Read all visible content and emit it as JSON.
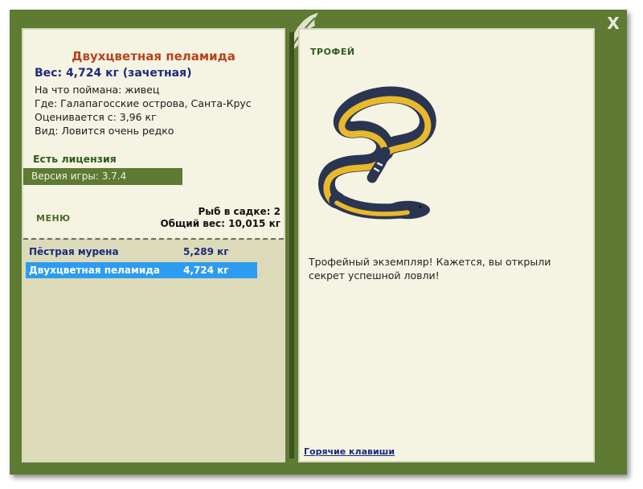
{
  "window": {
    "close_label": "X"
  },
  "fish": {
    "name": "Двухцветная пеламида",
    "weight_line": "Вес: 4,724 кг (зачетная)",
    "info": [
      "На что поймана: живец",
      "Где: Галапагосские острова, Санта-Крус",
      "Оценивается с: 3,96 кг",
      "Вид: Ловится очень редко"
    ]
  },
  "license": "Есть лицензия",
  "version": "Версия игры: 3.7.4",
  "menu_label": "МЕНЮ",
  "keepnet": {
    "count_line": "Рыб в садке: 2",
    "total_line": "Общий вес: 10,015 кг",
    "items": [
      {
        "name": "Пёстрая мурена",
        "weight": "5,289 кг",
        "selected": false
      },
      {
        "name": "Двухцветная пеламида",
        "weight": "4,724 кг",
        "selected": true
      }
    ]
  },
  "right_panel": {
    "trophy_label": "ТРОФЕЙ",
    "description": "Трофейный экземпляр! Кажется, вы открыли секрет успешной ловли!",
    "hotkeys_label": "Горячие клавиши"
  },
  "colors": {
    "frame": "#5e7a33",
    "panel": "#f5f4e3",
    "title": "#b8431c",
    "weight": "#1c2a7e",
    "selection": "#2d9cf0"
  },
  "icons": [
    "leaf-emblem-icon",
    "close-icon",
    "sea-snake-image"
  ]
}
